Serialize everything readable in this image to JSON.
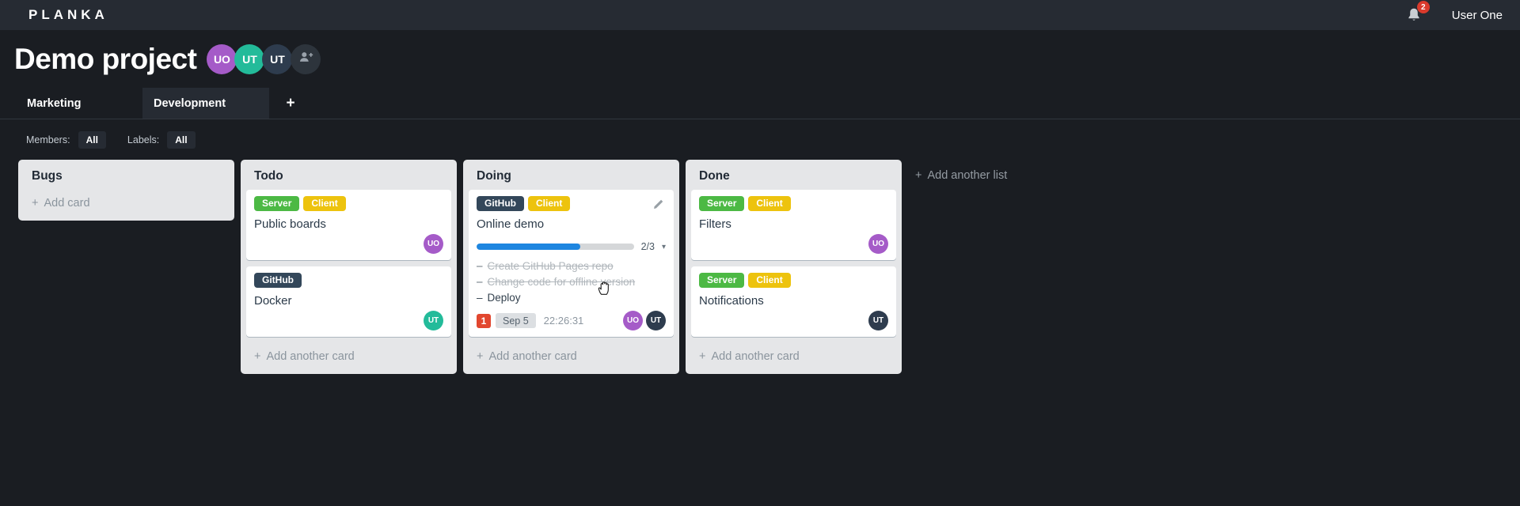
{
  "topbar": {
    "logo": "PLANKA",
    "notifications": {
      "count": "2",
      "badge_color": "#d93a2c"
    },
    "user_name": "User One"
  },
  "project": {
    "title": "Demo project",
    "members": [
      {
        "initials": "UO",
        "color": "#a55bc8"
      },
      {
        "initials": "UT",
        "color": "#23bb9a"
      },
      {
        "initials": "UT",
        "color": "#2e3c4e"
      }
    ]
  },
  "tabs": {
    "items": [
      {
        "label": "Marketing",
        "active": false
      },
      {
        "label": "Development",
        "active": true
      }
    ],
    "add_glyph": "+"
  },
  "filters": {
    "members_label": "Members:",
    "members_value": "All",
    "labels_label": "Labels:",
    "labels_value": "All"
  },
  "glyphs": {
    "plus": "+",
    "dash": "–",
    "caret": "▾"
  },
  "board": {
    "add_list_label": "Add another list",
    "lists": [
      {
        "title": "Bugs",
        "add_card_label": "Add card",
        "cards": []
      },
      {
        "title": "Todo",
        "add_card_label": "Add another card",
        "cards": [
          {
            "title": "Public boards",
            "labels": [
              {
                "text": "Server",
                "color": "#4cb944"
              },
              {
                "text": "Client",
                "color": "#edc30e"
              }
            ],
            "members": [
              {
                "initials": "UO",
                "color": "#a55bc8"
              }
            ]
          },
          {
            "title": "Docker",
            "labels": [
              {
                "text": "GitHub",
                "color": "#33475a"
              }
            ],
            "members": [
              {
                "initials": "UT",
                "color": "#23bb9a"
              }
            ]
          }
        ]
      },
      {
        "title": "Doing",
        "add_card_label": "Add another card",
        "cards": [
          {
            "title": "Online demo",
            "labels": [
              {
                "text": "GitHub",
                "color": "#33475a"
              },
              {
                "text": "Client",
                "color": "#edc30e"
              }
            ],
            "progress": {
              "label": "2/3",
              "percent": 66,
              "color": "#1e86e0"
            },
            "tasks": [
              {
                "text": "Create GitHub Pages repo",
                "done": true
              },
              {
                "text": "Change code for offline version",
                "done": true
              },
              {
                "text": "Deploy",
                "done": false
              }
            ],
            "notification_count": "1",
            "notification_color": "#e2472f",
            "due_date": "Sep 5",
            "timer": "22:26:31",
            "members": [
              {
                "initials": "UO",
                "color": "#a55bc8"
              },
              {
                "initials": "UT",
                "color": "#2e3c4e"
              }
            ]
          }
        ]
      },
      {
        "title": "Done",
        "add_card_label": "Add another card",
        "cards": [
          {
            "title": "Filters",
            "labels": [
              {
                "text": "Server",
                "color": "#4cb944"
              },
              {
                "text": "Client",
                "color": "#edc30e"
              }
            ],
            "members": [
              {
                "initials": "UO",
                "color": "#a55bc8"
              }
            ]
          },
          {
            "title": "Notifications",
            "labels": [
              {
                "text": "Server",
                "color": "#4cb944"
              },
              {
                "text": "Client",
                "color": "#edc30e"
              }
            ],
            "members": [
              {
                "initials": "UT",
                "color": "#2e3c4e"
              }
            ]
          }
        ]
      }
    ]
  }
}
